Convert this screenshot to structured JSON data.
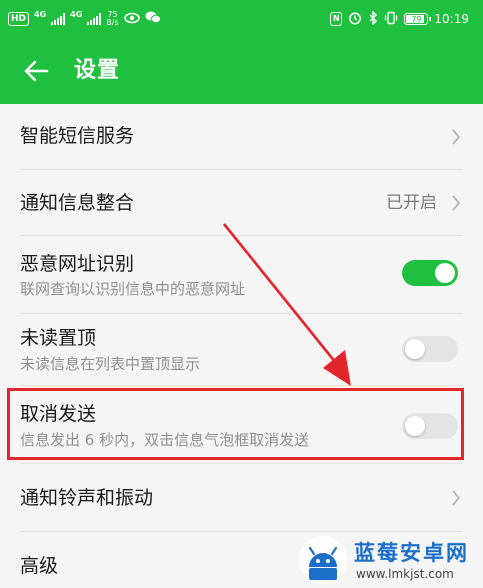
{
  "status_bar": {
    "hd_badge": "HD",
    "signal1_label": "4G",
    "signal2_label": "4G",
    "net_speed_value": "75",
    "net_speed_unit": "B/s",
    "nfc_label": "N",
    "battery_level": "79",
    "time": "10:19"
  },
  "header": {
    "title": "设置",
    "back_icon": "arrow-left-icon"
  },
  "settings": {
    "items": [
      {
        "title": "智能短信服务",
        "type": "link"
      },
      {
        "title": "通知信息整合",
        "value": "已开启",
        "type": "link"
      },
      {
        "title": "恶意网址识别",
        "subtitle": "联网查询以识别信息中的恶意网址",
        "type": "toggle",
        "on": true
      },
      {
        "title": "未读置顶",
        "subtitle": "未读信息在列表中置顶显示",
        "type": "toggle",
        "on": false
      },
      {
        "title": "取消发送",
        "subtitle": "信息发出 6 秒内，双击信息气泡框取消发送",
        "type": "toggle",
        "on": false
      },
      {
        "title": "通知铃声和振动",
        "type": "link"
      },
      {
        "title": "高级",
        "type": "link"
      }
    ]
  },
  "watermark": {
    "name": "蓝莓安卓网",
    "url": "www.lmkjst.com"
  },
  "colors": {
    "brand_green": "#1fbf3f",
    "highlight_red": "#e2262b",
    "watermark_blue": "#1b6fc9"
  }
}
